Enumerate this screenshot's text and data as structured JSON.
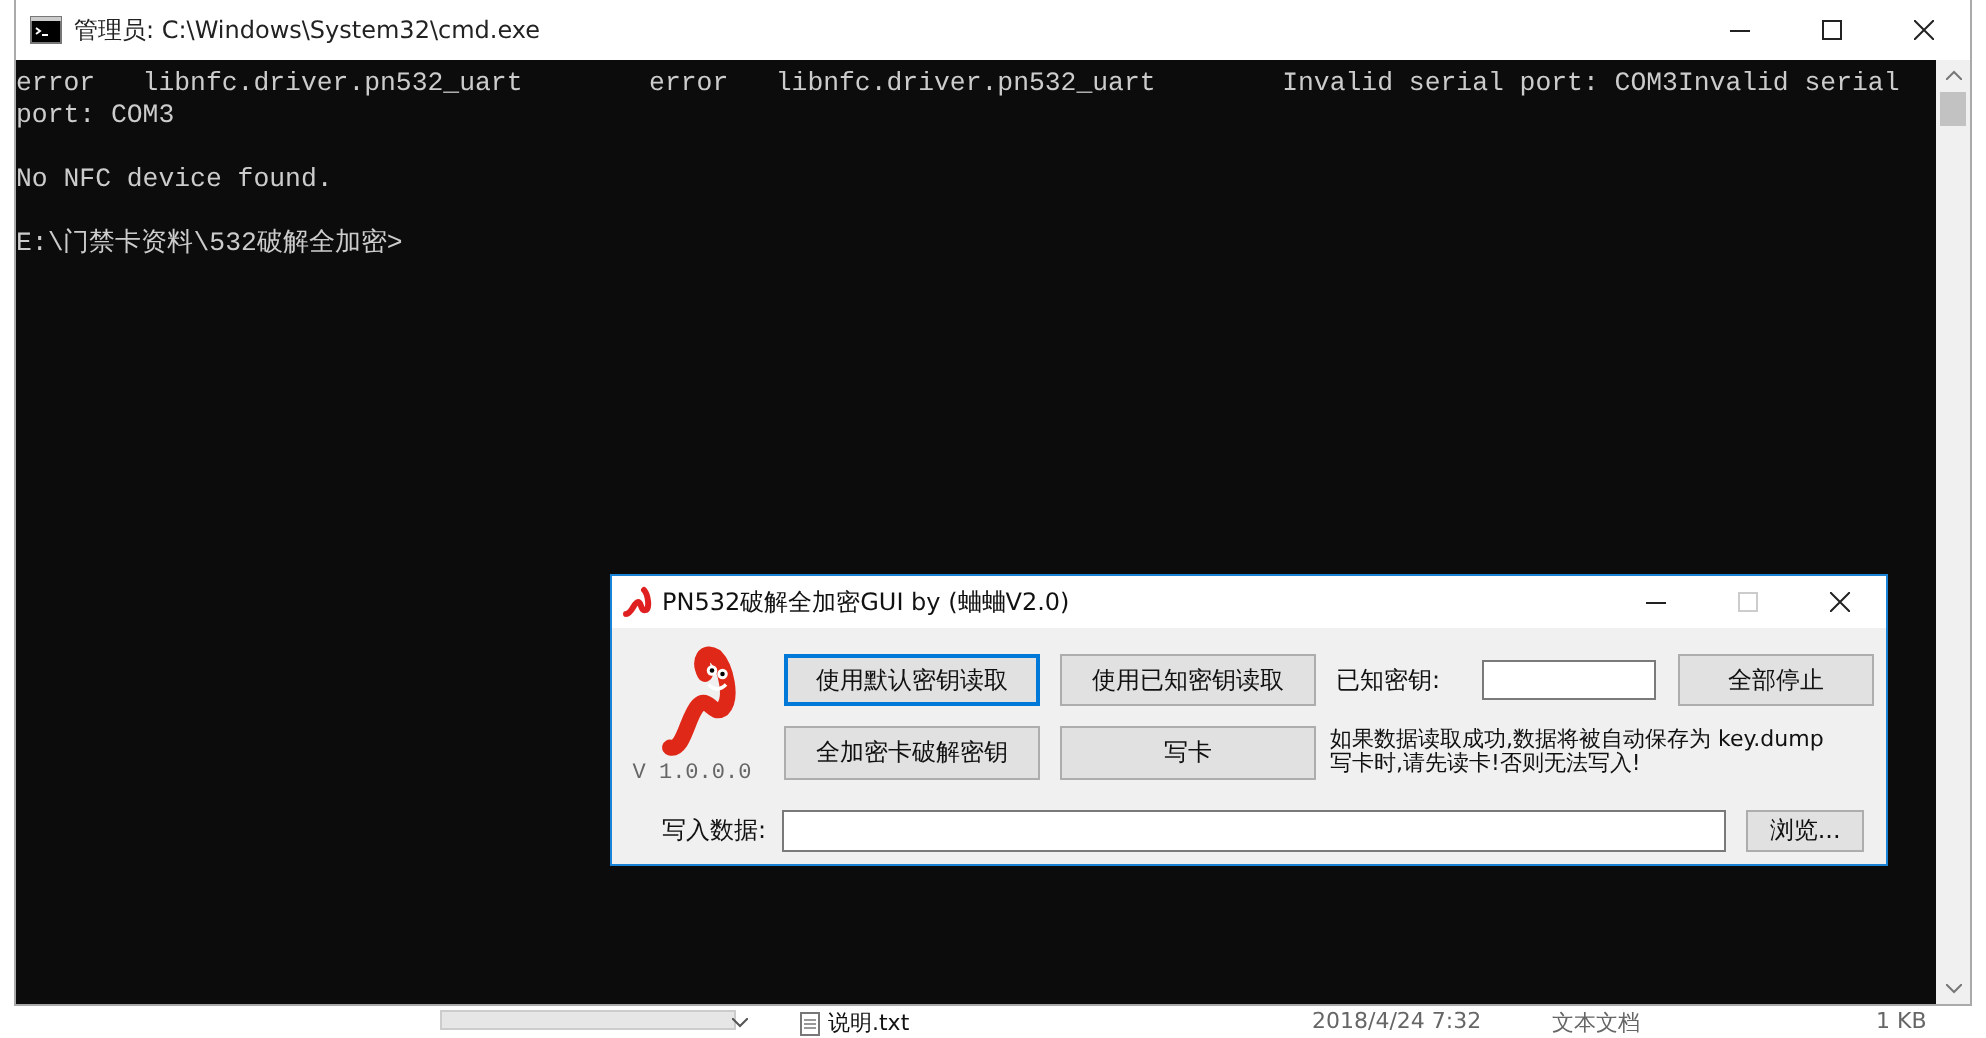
{
  "console_window": {
    "title": "管理员: C:\\Windows\\System32\\cmd.exe",
    "blocks": [
      [
        "error   libnfc.driver.pn532_uart        error   libnfc.driver.pn532_uart        Invalid serial port: COM3Invalid serial",
        "port: COM3"
      ],
      [
        "No NFC device found."
      ],
      [
        "E:\\门禁卡资料\\532破解全加密>"
      ]
    ]
  },
  "dialog": {
    "title": "PN532破解全加密GUI by (蛐蛐V2.0)",
    "maximize_disabled": true,
    "version": "V 1.0.0.0",
    "buttons": [
      {
        "label": "使用默认密钥读取",
        "focused": true
      },
      {
        "label": "使用已知密钥读取",
        "focused": false
      },
      {
        "label": "全加密卡破解密钥",
        "focused": false
      },
      {
        "label": "写卡",
        "focused": false
      }
    ],
    "known_key_label": "已知密钥:",
    "stop_button": "全部停止",
    "note_lines": [
      "如果数据读取成功,数据将被自动保存为 key.dump",
      "写卡时,请先读卡!否则无法写入!"
    ],
    "write_data_label": "写入数据:",
    "browse_button": "浏览..."
  },
  "explorer_row": {
    "name": "说明.txt",
    "modified": "2018/4/24 7:32",
    "type": "文本文档",
    "size": "1 KB"
  }
}
